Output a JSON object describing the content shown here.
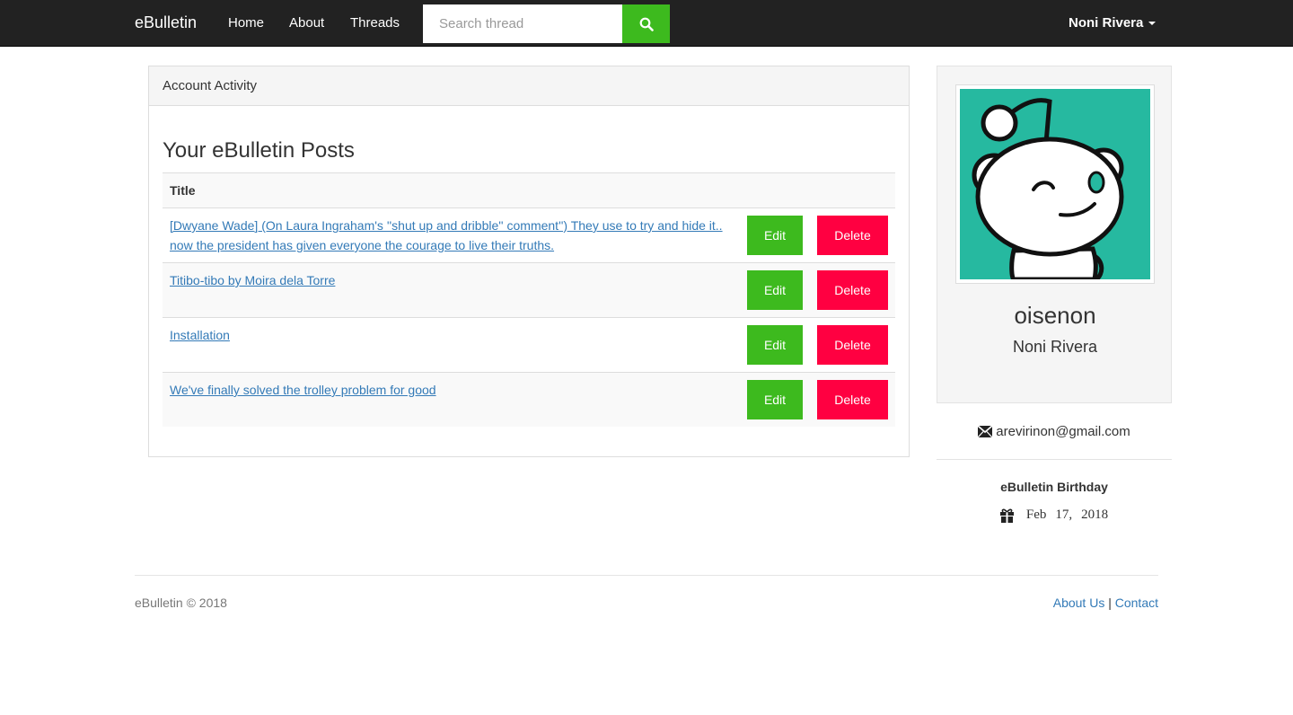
{
  "nav": {
    "brand": "eBulletin",
    "links": [
      "Home",
      "About",
      "Threads"
    ],
    "search_placeholder": "Search thread",
    "user": "Noni Rivera"
  },
  "panel": {
    "heading": "Account Activity",
    "title": "Your eBulletin Posts",
    "column_title": "Title",
    "edit_label": "Edit",
    "delete_label": "Delete",
    "posts": [
      "[Dwyane Wade] (On Laura Ingraham's ''shut up and dribble'' comment'') They use to try and hide it.. now the president has given everyone the courage to live their truths.",
      "Titibo-tibo by Moira dela Torre",
      "Installation",
      "We've finally solved the trolley problem for good"
    ]
  },
  "profile": {
    "username": "oisenon",
    "name": "Noni Rivera",
    "email": "arevirinon@gmail.com",
    "birthday_title": "eBulletin Birthday",
    "birthday_month": "Feb",
    "birthday_day": "17,",
    "birthday_year": "2018",
    "avatar_color": "#26b9a0"
  },
  "footer": {
    "copyright": "eBulletin © 2018",
    "about": "About Us",
    "separator": "|",
    "contact": "Contact"
  },
  "colors": {
    "navbar": "#222222",
    "edit": "#3dba1e",
    "delete": "#ff0041",
    "link": "#337ab7"
  }
}
